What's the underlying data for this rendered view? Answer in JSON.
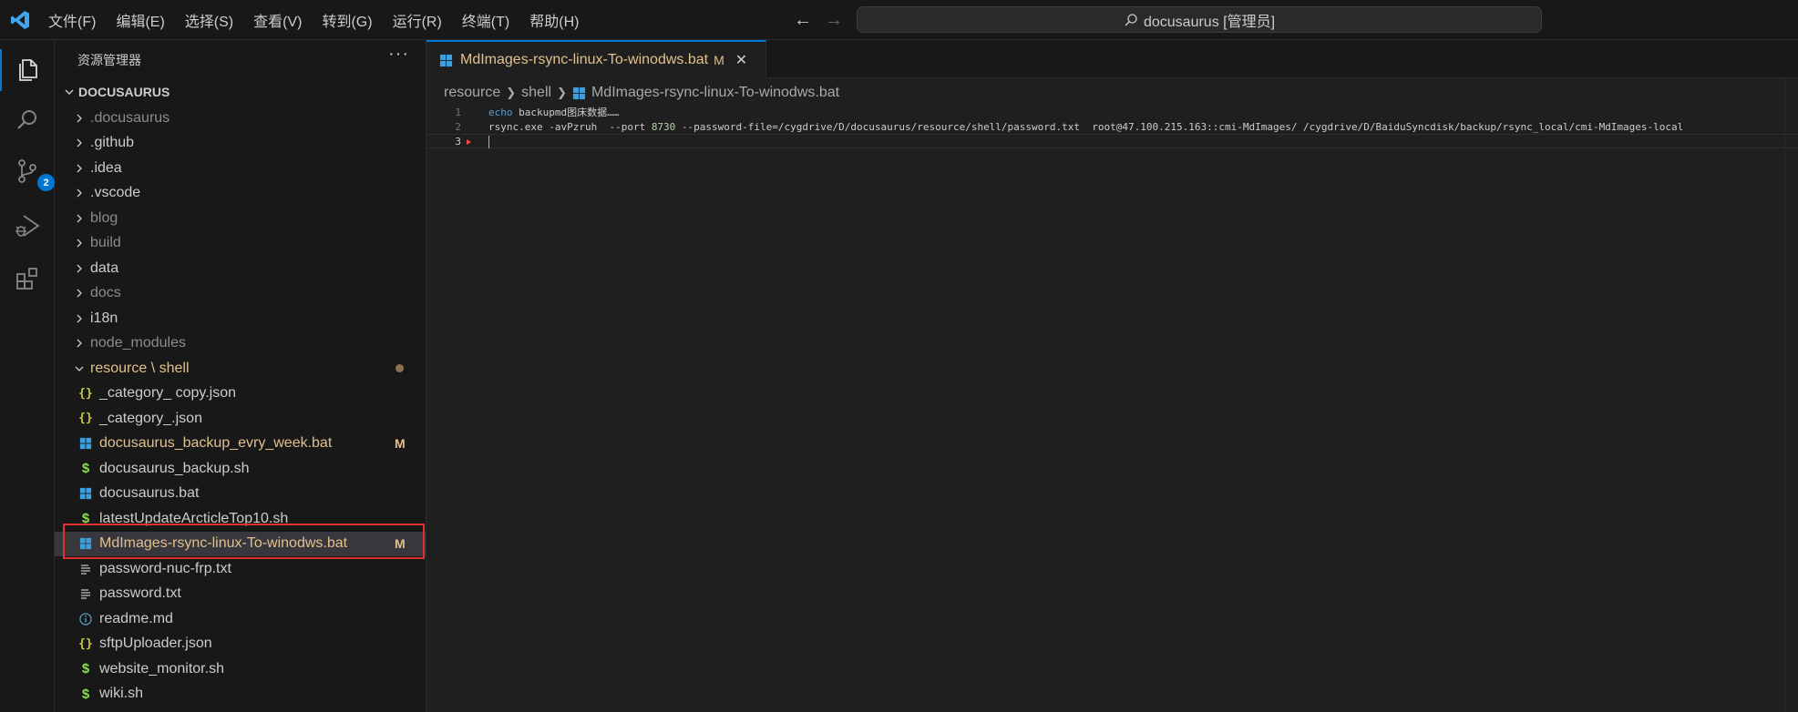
{
  "titlebar": {
    "menu": [
      "文件(F)",
      "编辑(E)",
      "选择(S)",
      "查看(V)",
      "转到(G)",
      "运行(R)",
      "终端(T)",
      "帮助(H)"
    ],
    "command_center": "docusaurus [管理员]"
  },
  "activity_bar": {
    "icons": [
      "explorer-icon",
      "search-icon",
      "source-control-icon",
      "run-debug-icon",
      "extensions-icon"
    ],
    "source_control_badge": "2",
    "accent_color": "#0078d4"
  },
  "sidebar": {
    "title": "资源管理器",
    "more": "···",
    "root_folder": "DOCUSAURUS",
    "items": [
      {
        "label": ".docusaurus",
        "type": "folder",
        "dim": true
      },
      {
        "label": ".github",
        "type": "folder"
      },
      {
        "label": ".idea",
        "type": "folder"
      },
      {
        "label": ".vscode",
        "type": "folder"
      },
      {
        "label": "blog",
        "type": "folder",
        "dim": true
      },
      {
        "label": "build",
        "type": "folder",
        "dim": true
      },
      {
        "label": "data",
        "type": "folder"
      },
      {
        "label": "docs",
        "type": "folder",
        "dim": true
      },
      {
        "label": "i18n",
        "type": "folder"
      },
      {
        "label": "node_modules",
        "type": "folder",
        "dim": true
      },
      {
        "label": "resource \\ shell",
        "type": "folder-open",
        "modified_color": "#e2c08d"
      },
      {
        "label": "_category_ copy.json",
        "type": "json"
      },
      {
        "label": "_category_.json",
        "type": "json"
      },
      {
        "label": "docusaurus_backup_evry_week.bat",
        "type": "bat",
        "mark": "M"
      },
      {
        "label": "docusaurus_backup.sh",
        "type": "sh"
      },
      {
        "label": "docusaurus.bat",
        "type": "bat"
      },
      {
        "label": "latestUpdateArcticleTop10.sh",
        "type": "sh"
      },
      {
        "label": "MdImages-rsync-linux-To-winodws.bat",
        "type": "bat",
        "mark": "M",
        "selected": true
      },
      {
        "label": "password-nuc-frp.txt",
        "type": "txt"
      },
      {
        "label": "password.txt",
        "type": "txt"
      },
      {
        "label": "readme.md",
        "type": "md"
      },
      {
        "label": "sftpUploader.json",
        "type": "json"
      },
      {
        "label": "website_monitor.sh",
        "type": "sh"
      },
      {
        "label": "wiki.sh",
        "type": "sh"
      }
    ]
  },
  "editor": {
    "tab": {
      "label": "MdImages-rsync-linux-To-winodws.bat",
      "mark": "M",
      "close": "✕"
    },
    "breadcrumb": [
      "resource",
      "shell",
      "MdImages-rsync-linux-To-winodws.bat"
    ],
    "lines": [
      {
        "number": "1",
        "keyword": "echo",
        "text": " backupmd图床数据……"
      },
      {
        "number": "2",
        "text": "rsync.exe -avPzruh  --port ",
        "port": "8730",
        "rest": " --password-file=/cygdrive/D/docusaurus/resource/shell/password.txt  root@47.100.215.163::cmi-MdImages/ /cygdrive/D/BaiduSyncdisk/backup/rsync_local/cmi-MdImages-local"
      },
      {
        "number": "3",
        "text": ""
      }
    ]
  },
  "colors": {
    "modified": "#e2c08d",
    "annotation": "#e0312f",
    "bat_icon": "#3c9fe0",
    "json_icon": "#cbcb41",
    "sh_icon": "#89e051",
    "md_icon": "#519aba"
  }
}
